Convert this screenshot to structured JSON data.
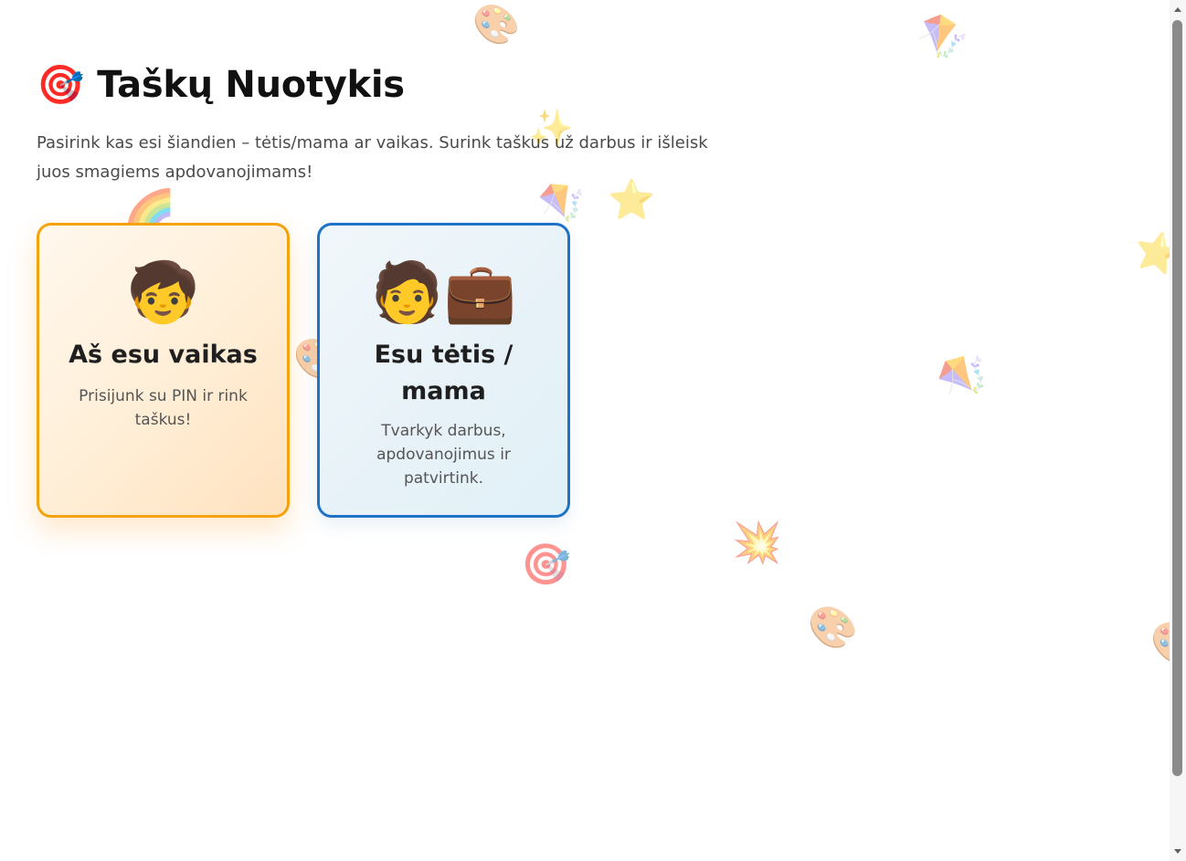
{
  "header": {
    "icon": "🎯",
    "title": "Taškų Nuotykis",
    "intro": "Pasirink kas esi šiandien – tėtis/mama ar vaikas. Surink taškus už darbus ir išleisk juos smagiems apdovanojimams!"
  },
  "cards": {
    "kid": {
      "emoji": "🧒",
      "title": "Aš esu vaikas",
      "description": "Prisijunk su PIN ir rink taškus!",
      "accent": "#f4a20e"
    },
    "parent": {
      "emoji": "🧑💼",
      "title": "Esu tėtis / mama",
      "description": "Tvarkyk darbus, apdovanojimus ir patvirtink.",
      "accent": "#1f73c7"
    }
  },
  "decorations": {
    "palette": "🎨",
    "kite": "🪁",
    "star": "⭐",
    "sparkles": "✨",
    "rainbow": "🌈",
    "burst": "💥",
    "target": "🎯"
  }
}
